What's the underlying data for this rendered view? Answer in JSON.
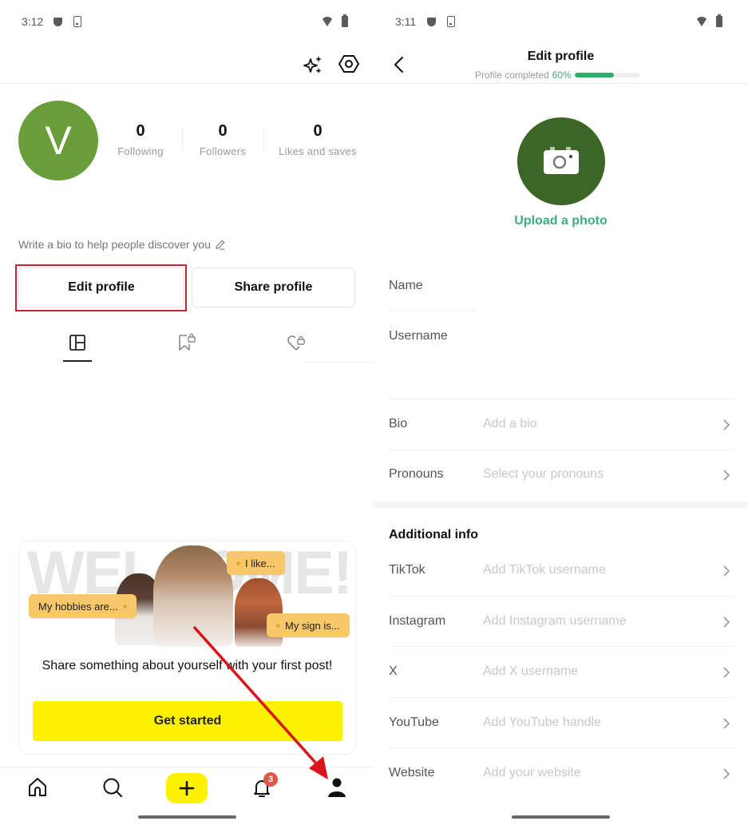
{
  "left": {
    "status": {
      "time": "3:12"
    },
    "topbar": {
      "sparkle_icon": "sparkle-icon",
      "settings_icon": "hexagon-gear-icon"
    },
    "avatar": {
      "initial": "V",
      "color": "#6a9e3a"
    },
    "stats": [
      {
        "value": "0",
        "label": "Following"
      },
      {
        "value": "0",
        "label": "Followers"
      },
      {
        "value": "0",
        "label": "Likes and saves"
      }
    ],
    "bio_hint": "Write a bio to help people discover you",
    "buttons": {
      "edit": "Edit profile",
      "share": "Share profile"
    },
    "tabs": [
      {
        "icon": "grid-icon",
        "active": true
      },
      {
        "icon": "bookmark-lock-icon",
        "active": false
      },
      {
        "icon": "heart-lock-icon",
        "active": false
      }
    ],
    "welcome": {
      "art_word": "WELCOME!",
      "bubbles": [
        "I like...",
        "My hobbies are...",
        "My sign is..."
      ],
      "text": "Share something about yourself with your first post!",
      "cta": "Get started",
      "cta_color": "#fff200"
    },
    "nav": {
      "items": [
        "home",
        "search",
        "create",
        "notifications",
        "profile"
      ],
      "notification_count": "3",
      "active": "profile"
    },
    "annotation": {
      "highlight_target": "Edit profile",
      "arrow_target": "profile",
      "color": "#c8262c"
    }
  },
  "right": {
    "status": {
      "time": "3:11"
    },
    "header": {
      "title": "Edit profile",
      "progress_label": "Profile completed",
      "progress_text": "60%",
      "progress_value": 0.6,
      "accent": "#2fad6c"
    },
    "photo": {
      "upload_label": "Upload a photo"
    },
    "fields": {
      "name_label": "Name",
      "username_label": "Username"
    },
    "rows_main": [
      {
        "label": "Bio",
        "placeholder": "Add a bio"
      },
      {
        "label": "Pronouns",
        "placeholder": "Select your pronouns"
      }
    ],
    "additional_title": "Additional info",
    "rows_additional": [
      {
        "label": "TikTok",
        "placeholder": "Add TikTok username"
      },
      {
        "label": "Instagram",
        "placeholder": "Add Instagram username"
      },
      {
        "label": "X",
        "placeholder": "Add X username"
      },
      {
        "label": "YouTube",
        "placeholder": "Add YouTube handle"
      },
      {
        "label": "Website",
        "placeholder": "Add your website"
      }
    ]
  }
}
